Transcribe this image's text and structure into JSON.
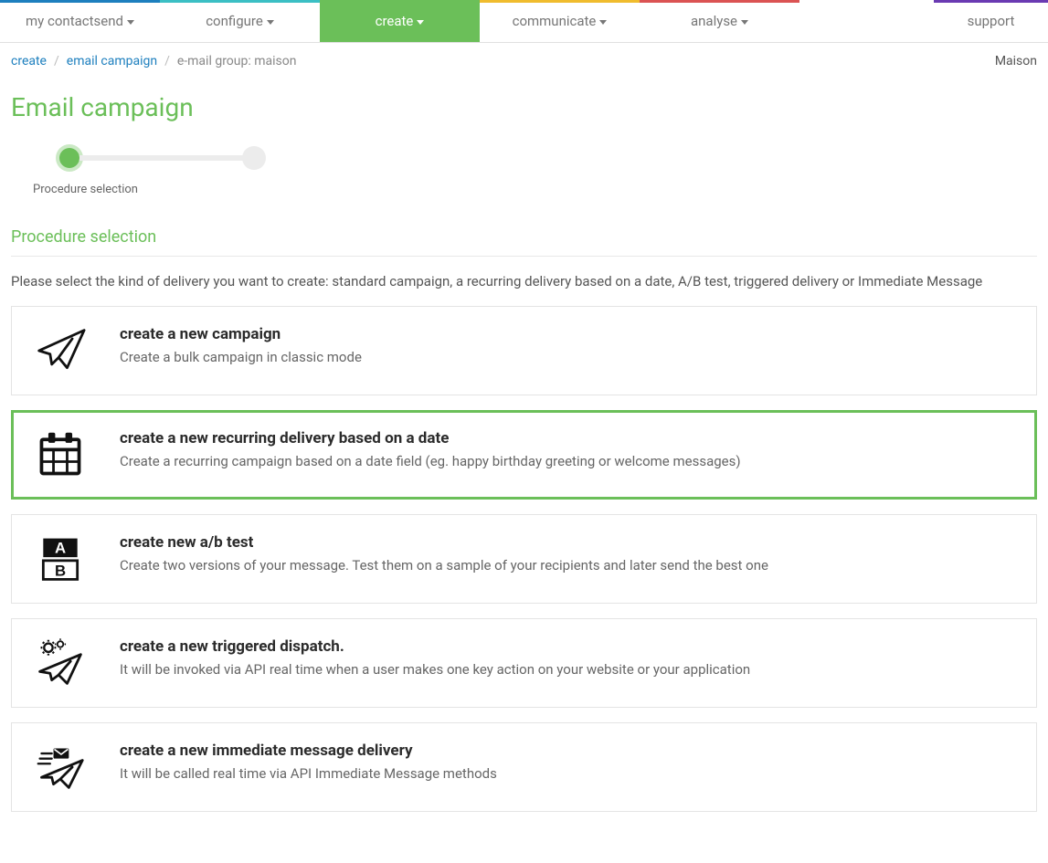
{
  "nav": {
    "tabs": [
      {
        "label": "my contactsend",
        "color": "blue",
        "caret": true
      },
      {
        "label": "configure",
        "color": "cyan",
        "caret": true
      },
      {
        "label": "create",
        "color": "green",
        "caret": true,
        "active": true
      },
      {
        "label": "communicate",
        "color": "yellow",
        "caret": true
      },
      {
        "label": "analyse",
        "color": "red",
        "caret": true
      }
    ],
    "support_label": "support"
  },
  "breadcrumb": {
    "items": [
      {
        "label": "create",
        "link": true
      },
      {
        "label": "email campaign",
        "link": true
      },
      {
        "label": "e-mail group: maison",
        "link": false
      }
    ],
    "right": "Maison"
  },
  "page_title": "Email campaign",
  "step_label": "Procedure selection",
  "section": {
    "title": "Procedure selection",
    "desc": "Please select the kind of delivery you want to create: standard campaign, a recurring delivery based on a date, A/B test, triggered delivery or Immediate Message"
  },
  "options": [
    {
      "icon": "paperplane",
      "title": "create a new campaign",
      "desc": "Create a bulk campaign in classic mode",
      "selected": false
    },
    {
      "icon": "calendar",
      "title": "create a new recurring delivery based on a date",
      "desc": "Create a recurring campaign based on a date field (eg. happy birthday greeting or welcome messages)",
      "selected": true
    },
    {
      "icon": "abtest",
      "title": "create new a/b test",
      "desc": "Create two versions of your message. Test them on a sample of your recipients and later send the best one",
      "selected": false
    },
    {
      "icon": "gearplane",
      "title": "create a new triggered dispatch.",
      "desc": "It will be invoked via API real time when a user makes one key action on your website or your application",
      "selected": false
    },
    {
      "icon": "mailplane",
      "title": "create a new immediate message delivery",
      "desc": "It will be called real time via API Immediate Message methods",
      "selected": false
    }
  ]
}
